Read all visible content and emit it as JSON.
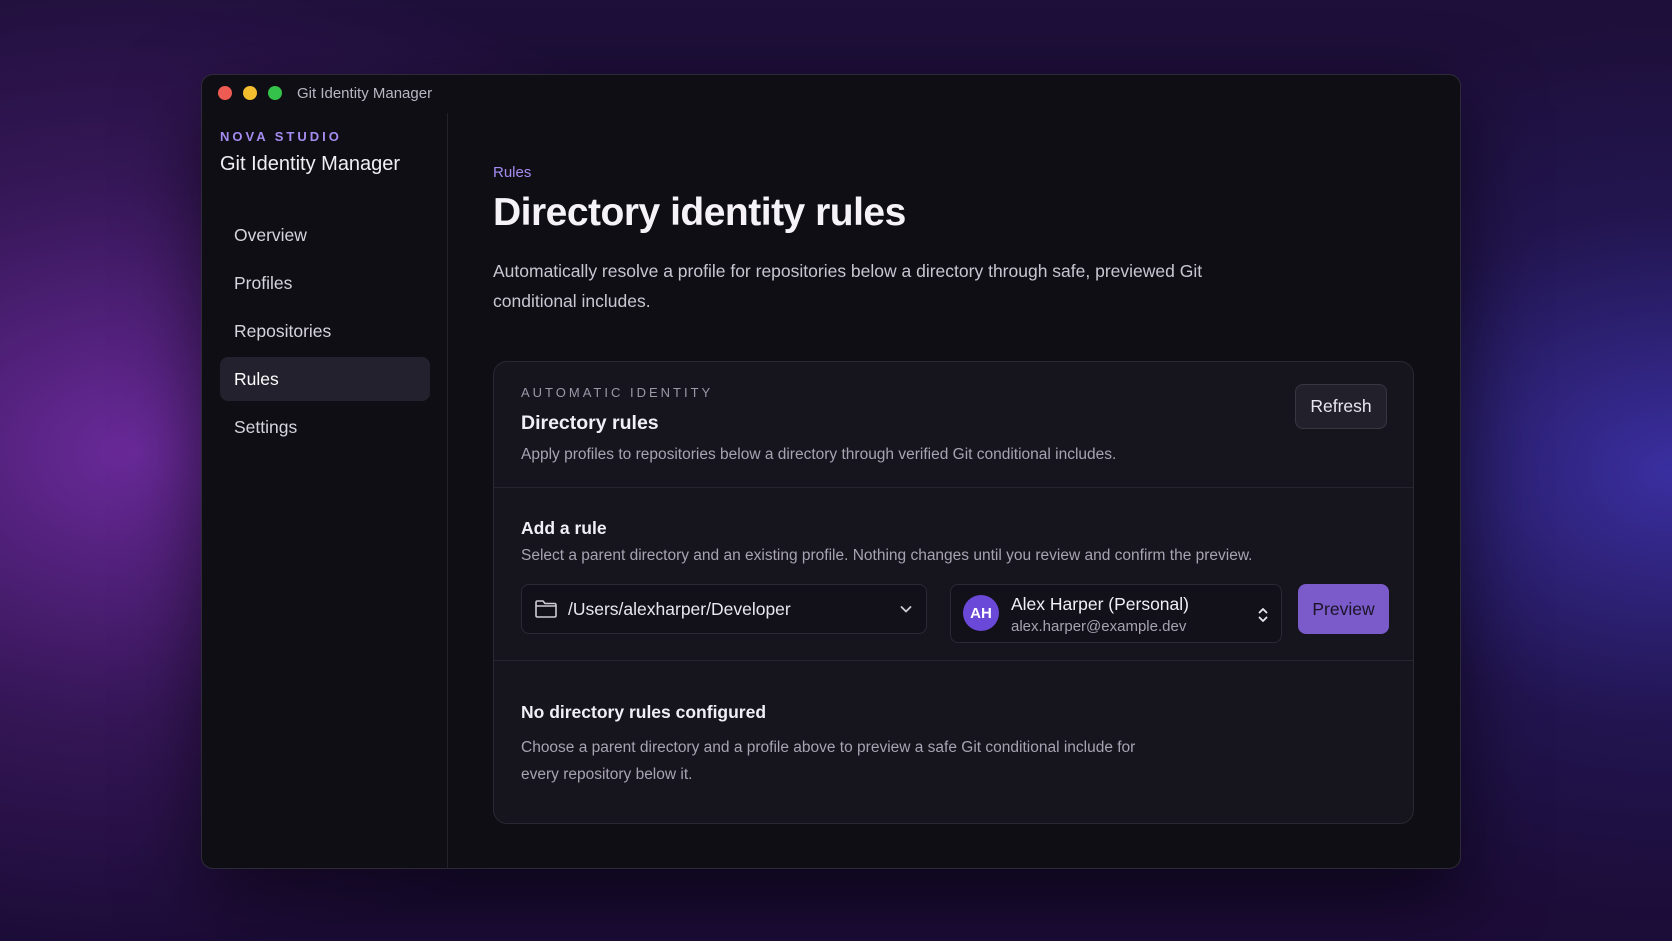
{
  "window": {
    "title": "Git Identity Manager"
  },
  "sidebar": {
    "kicker": "NOVA STUDIO",
    "app_name": "Git Identity Manager",
    "items": [
      {
        "label": "Overview",
        "active": false
      },
      {
        "label": "Profiles",
        "active": false
      },
      {
        "label": "Repositories",
        "active": false
      },
      {
        "label": "Rules",
        "active": true
      },
      {
        "label": "Settings",
        "active": false
      }
    ]
  },
  "main": {
    "breadcrumb": "Rules",
    "title": "Directory identity rules",
    "description": "Automatically resolve a profile for repositories below a directory through safe, previewed Git conditional includes.",
    "card": {
      "kicker": "AUTOMATIC IDENTITY",
      "title": "Directory rules",
      "description": "Apply profiles to repositories below a directory through verified Git conditional includes.",
      "refresh_label": "Refresh",
      "add_rule": {
        "title": "Add a rule",
        "description": "Select a parent directory and an existing profile. Nothing changes until you review and confirm the preview.",
        "directory_value": "/Users/alexharper/Developer",
        "profile": {
          "initials": "AH",
          "name": "Alex Harper (Personal)",
          "email": "alex.harper@example.dev"
        },
        "preview_label": "Preview"
      },
      "empty": {
        "title": "No directory rules configured",
        "description": "Choose a parent directory and a profile above to preview a safe Git conditional include for every repository below it."
      }
    }
  },
  "colors": {
    "accent": "#a48cf0",
    "preview_button": "#7b5ac9",
    "avatar": "#6a48d8"
  },
  "icons": {
    "folder": "folder-icon",
    "chevron": "chevron-down-icon",
    "updown": "chevron-updown-icon"
  }
}
